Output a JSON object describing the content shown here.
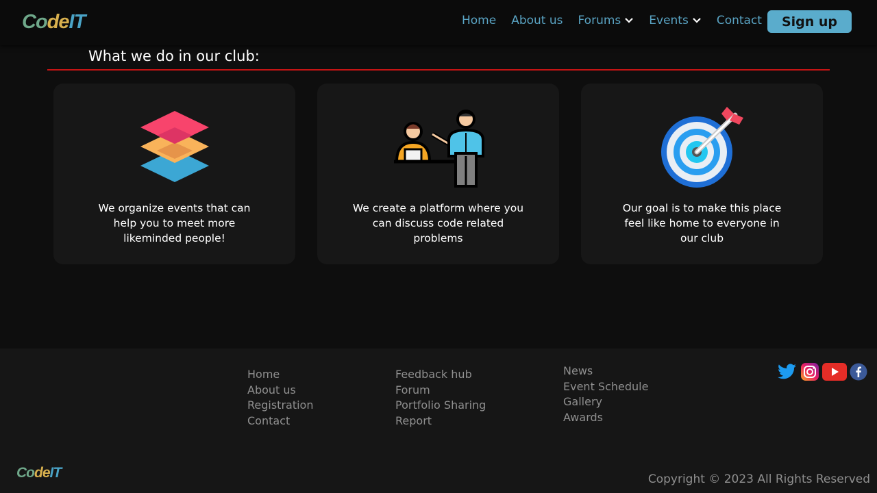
{
  "brand": {
    "part1": "Co",
    "part2": "de",
    "part3": "IT"
  },
  "nav": {
    "home": "Home",
    "about": "About us",
    "forums": "Forums",
    "events": "Events",
    "contact": "Contact",
    "signup": "Sign up"
  },
  "section": {
    "title": "What we do in our club:"
  },
  "cards": [
    {
      "icon": "layers-icon",
      "text": "We organize events that can help you to meet more likeminded people!"
    },
    {
      "icon": "presentation-icon",
      "text": "We create a platform where you can discuss code related problems"
    },
    {
      "icon": "target-icon",
      "text": "Our goal is to make this place feel like home to everyone in our club"
    }
  ],
  "footer": {
    "col1": [
      "Home",
      "About us",
      "Registration",
      "Contact"
    ],
    "col2": [
      "Feedback hub",
      "Forum",
      "Portfolio Sharing",
      "Report"
    ],
    "col3": [
      "News",
      "Event Schedule",
      "Gallery",
      "Awards"
    ],
    "socials": [
      "twitter-icon",
      "instagram-icon",
      "youtube-icon",
      "facebook-icon"
    ],
    "copyright": "Copyright © 2023 All Rights Reserved"
  },
  "colors": {
    "accent": "#5aaccc",
    "rule": "#c41414",
    "card_bg": "#171717",
    "footer_bg": "#161616"
  }
}
